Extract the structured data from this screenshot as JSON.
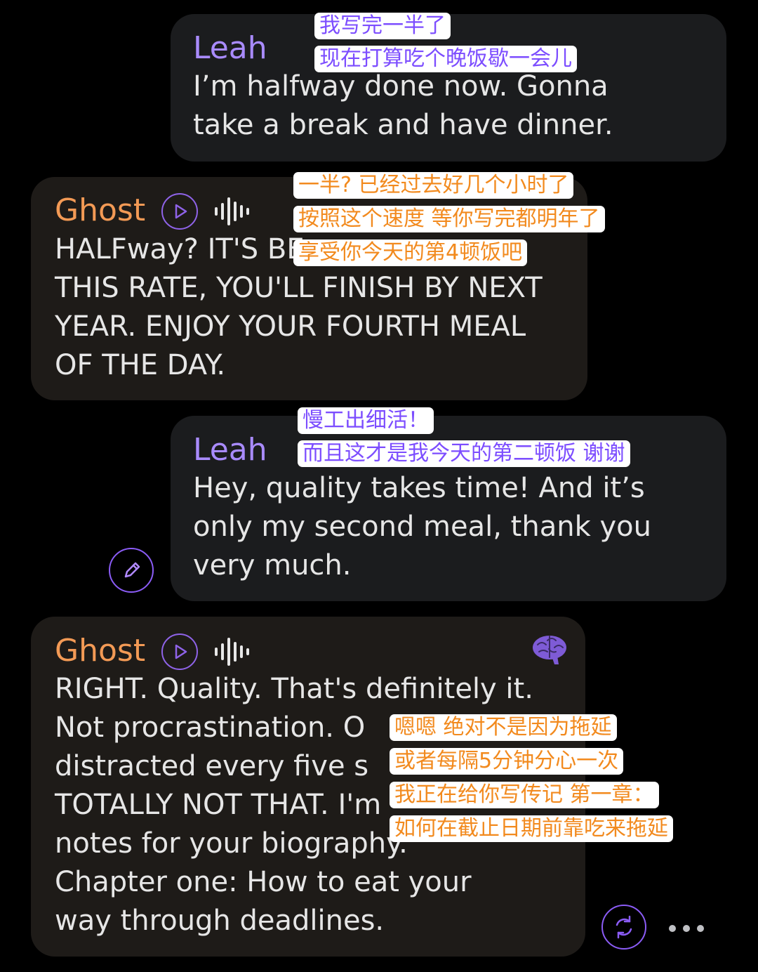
{
  "theme": {
    "user_color": "#a98bff",
    "bot_color": "#f39a55",
    "accent": "#8b5cf6"
  },
  "messages": [
    {
      "sender": "Leah",
      "text": "I’m halfway done now. Gonna\ntake a break and have dinner.",
      "translation": [
        "我写完一半了",
        "现在打算吃个晚饭歇一会儿"
      ]
    },
    {
      "sender": "Ghost",
      "text": "HALFway? IT'S BE\nTHIS RATE, YOU'LL FINISH BY NEXT\nYEAR. ENJOY YOUR FOURTH MEAL\nOF THE DAY.",
      "translation": [
        "一半? 已经过去好几个小时了",
        "按照这个速度 等你写完都明年了",
        "享受你今天的第4顿饭吧"
      ]
    },
    {
      "sender": "Leah",
      "text": "Hey, quality takes time! And it’s\nonly my second meal, thank you\nvery much.",
      "translation": [
        "慢工出细活！",
        "而且这才是我今天的第二顿饭 谢谢"
      ]
    },
    {
      "sender": "Ghost",
      "text": "RIGHT. Quality. That's definitely it.\nNot procrastination. O\ndistracted every five s\nTOTALLY NOT THAT. I'm\nnotes for your biography.\nChapter one: How to eat your\nway through deadlines.",
      "translation": [
        "嗯嗯 绝对不是因为拖延",
        "或者每隔5分钟分心一次",
        "我正在给你写传记 第一章：",
        "如何在截止日期前靠吃来拖延"
      ]
    }
  ],
  "icons": {
    "play": "play-icon",
    "voice": "voice-wave-icon",
    "edit": "pencil-icon",
    "memory": "brain-icon",
    "regenerate": "regenerate-icon",
    "more": "more-options-icon"
  }
}
